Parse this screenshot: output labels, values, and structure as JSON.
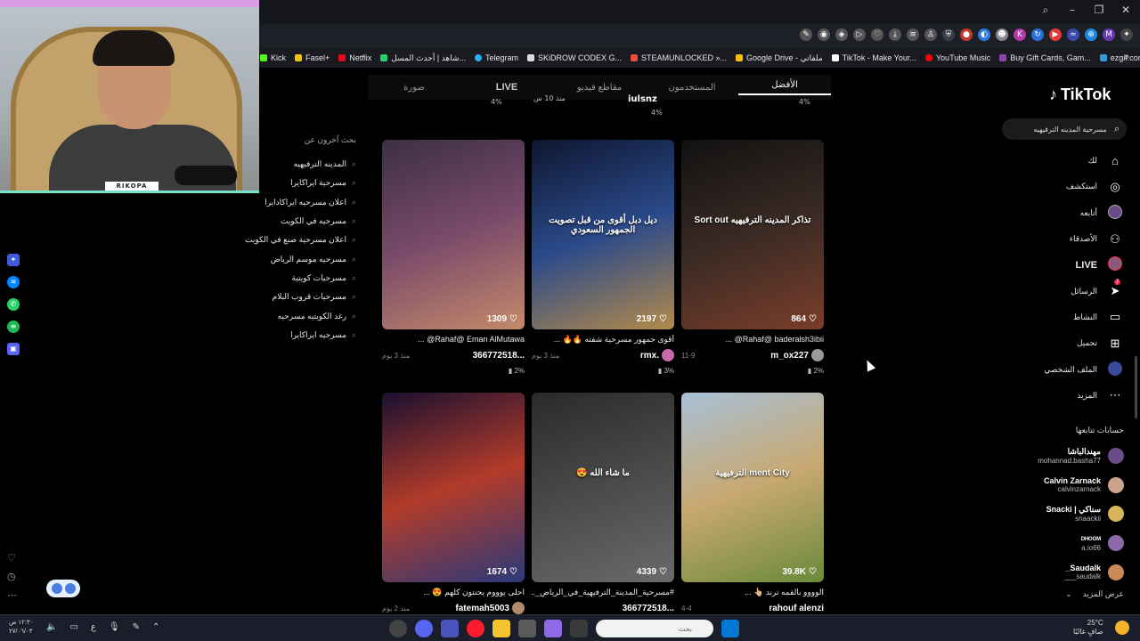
{
  "bookmarks": [
    "Kick",
    "Fasel+",
    "Netflix",
    "شاهد | أحدث المسل...",
    "Telegram",
    "SKiDROW CODEX G...",
    "STEAMUNLOCKED »...",
    "Google Drive - ملفاتي",
    "TikTok - Make Your...",
    "YouTube Music",
    "Buy Gift Cards, Gam...",
    "ezgif.com free onlin..."
  ],
  "webcam": {
    "name": "RIKOPA"
  },
  "related": {
    "title": "بحث آخرون عن",
    "items": [
      "المدينه الترفيهيه",
      "مسرحية ايراكايرا",
      "اعلان مسرحيه ايراكادايرا",
      "مسرحيه في الكويت",
      "اعلان مسرحية صنع في الكويت",
      "مسرحيه موسم الرياض",
      "مسرحيات كويتية",
      "مسرحيات قروب البلام",
      "رغد الكويتيه مسرحيه",
      "مسرحيه ايراكايرا"
    ]
  },
  "tabs": [
    "الأفضل",
    "المستخدمون",
    "مقاطع فيديو",
    "LIVE",
    "صورة"
  ],
  "top_stats": {
    "a": "4%",
    "b": "iulsnz",
    "c": "4%",
    "d": "منذ 10 س",
    "e": "4%"
  },
  "cards": [
    {
      "likes": "1309",
      "caption": "Rahaf@ Eman AlMutawa@ ...",
      "user": "366772518...",
      "time": "منذ 3 يوم",
      "pct": "2%",
      "colors": [
        "#3b2f45",
        "#7a4a6a",
        "#c58a6a"
      ]
    },
    {
      "likes": "2197",
      "caption": "أقوى جمهور مسرحية شفته 🔥🔥 ...",
      "user": "rmx.",
      "time": "منذ 3 يوم",
      "pct": "3%",
      "colors": [
        "#0d1630",
        "#2b4a8a",
        "#b38a4a"
      ],
      "overlay": "ديل دبل أقوى من قبل تصويت الجمهور السعودي"
    },
    {
      "likes": "864",
      "caption": "Rahaf@ baderalsh3ibii@ ...",
      "user": "m_ox227",
      "time": "11-9",
      "pct": "2%",
      "colors": [
        "#111111",
        "#3a2a24",
        "#7a3e2a"
      ],
      "overlay": "تذاكر المدينه الترفيهيه Sort out"
    },
    {
      "likes": "1674",
      "caption": "احلى يوووم يحنتون كلهم 😍 ...",
      "user": "fatemah5003",
      "time": "منذ 2 يوم",
      "pct": "",
      "colors": [
        "#1a1030",
        "#b23b2a",
        "#2a3a7a"
      ]
    },
    {
      "likes": "4339",
      "caption": "#مسرحية_المدينة_الترفيهية_في_الرياض_...",
      "user": "366772518...",
      "time": "",
      "pct": "",
      "colors": [
        "#2a2a2a",
        "#4a4a4a",
        "#6a6a6a"
      ],
      "overlay": "ما شاء الله 😍"
    },
    {
      "likes": "39.8K",
      "caption": "الوووو بالقمه ترند 👆🏼 ...",
      "user": "rahouf alenzi",
      "time": "4-4",
      "pct": "",
      "colors": [
        "#a8c0d8",
        "#c8a870",
        "#6a8a3a"
      ],
      "overlay": "ment City الترفيهية"
    }
  ],
  "tiktok": {
    "logo": "TikTok",
    "search_value": "مسرحية المدينه الترفيهيه",
    "nav": [
      {
        "label": "لك",
        "icon": "home-icon"
      },
      {
        "label": "استكشف",
        "icon": "compass-icon"
      },
      {
        "label": "أتابعه",
        "icon": "following-icon"
      },
      {
        "label": "الأصدقاء",
        "icon": "friends-icon"
      },
      {
        "label": "LIVE",
        "icon": "live-icon"
      },
      {
        "label": "الرسائل",
        "icon": "messages-icon",
        "badge": "7"
      },
      {
        "label": "النشاط",
        "icon": "activity-icon"
      },
      {
        "label": "تحميل",
        "icon": "upload-icon"
      },
      {
        "label": "الملف الشخصي",
        "icon": "profile-icon"
      },
      {
        "label": "المزيد",
        "icon": "more-icon"
      }
    ],
    "following_title": "حسابات تتابعها",
    "following": [
      {
        "name": "مهندالباشا",
        "handle": "mohannad.basha77",
        "color": "#6a4a8a"
      },
      {
        "name": "Calvin Zarnack",
        "handle": "calvinzarnack",
        "color": "#c9a38a"
      },
      {
        "name": "Snacki | سناكي",
        "handle": "snaackii",
        "color": "#d9b35a"
      },
      {
        "name": "ᴰᴴᴼᴼᴹ",
        "handle": "a.io66",
        "color": "#8a6aa8"
      },
      {
        "name": "_Saudalk",
        "handle": "___saudalk",
        "color": "#c98a5a"
      }
    ],
    "see_more": "عرض المزيد"
  },
  "taskbar": {
    "time": "١٢:٣٠ ص",
    "date": "٢٧/٠٦/٠٣",
    "search_placeholder": "بحث",
    "weather_temp": "25°C",
    "weather_desc": "صافٍ غالبًا"
  }
}
